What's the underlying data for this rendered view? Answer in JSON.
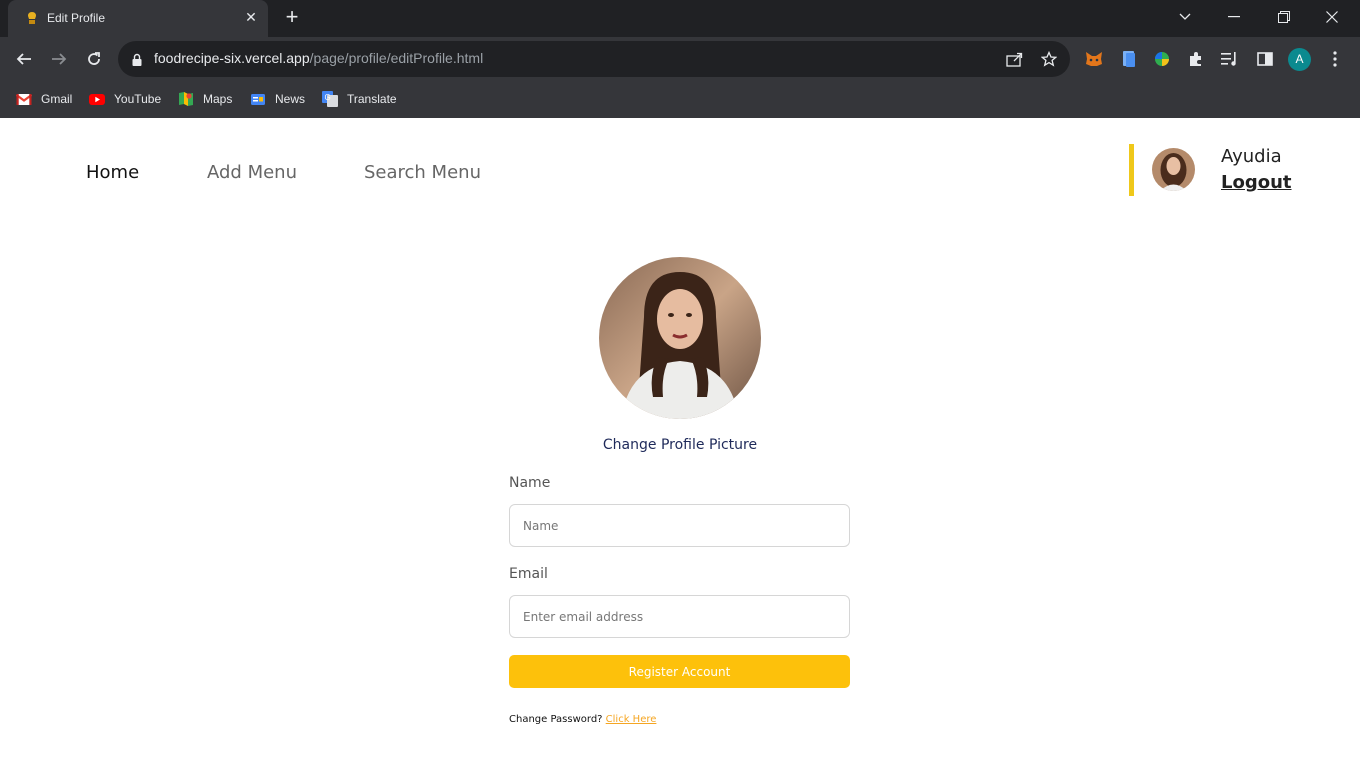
{
  "browser": {
    "tab_title": "Edit Profile",
    "url_host": "foodrecipe-six.vercel.app",
    "url_path": "/page/profile/editProfile.html",
    "profile_initial": "A",
    "bookmarks": [
      {
        "label": "Gmail",
        "icon": "gmail-icon"
      },
      {
        "label": "YouTube",
        "icon": "youtube-icon"
      },
      {
        "label": "Maps",
        "icon": "maps-icon"
      },
      {
        "label": "News",
        "icon": "news-icon"
      },
      {
        "label": "Translate",
        "icon": "translate-icon"
      }
    ]
  },
  "nav": {
    "home": "Home",
    "add_menu": "Add Menu",
    "search_menu": "Search Menu"
  },
  "user": {
    "name": "Ayudia",
    "logout": "Logout"
  },
  "profile": {
    "change_picture": "Change Profile Picture"
  },
  "form": {
    "name_label": "Name",
    "name_placeholder": "Name",
    "email_label": "Email",
    "email_placeholder": "Enter email address",
    "submit_label": "Register Account",
    "change_password_text": "Change Password?",
    "change_password_link": "Click Here"
  },
  "colors": {
    "accent": "#fdc10b",
    "user_bar": "#efc81a",
    "link": "#f5a623",
    "change_picture": "#1f2a5a"
  }
}
